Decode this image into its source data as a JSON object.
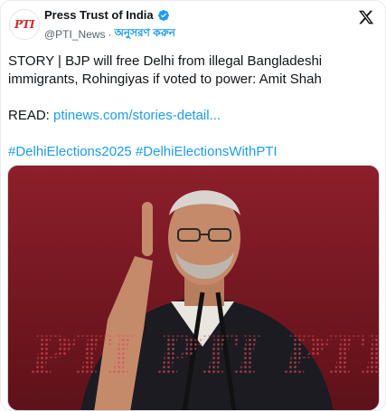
{
  "account": {
    "display_name": "Press Trust of India",
    "handle": "@PTI_News",
    "separator": "·",
    "follow_label": "অনুসরণ করুন",
    "avatar_text": "PTI"
  },
  "tweet": {
    "line1": "STORY | BJP will free Delhi from illegal Bangladeshi immigrants, Rohingiyas if voted to power: Amit Shah",
    "read_prefix": "READ: ",
    "link_text": "ptinews.com/stories-detail...",
    "hashtags": "#DelhiElections2025 #DelhiElectionsWithPTI"
  },
  "media": {
    "watermark": "PTI",
    "colors": {
      "background": "#7a1a24",
      "accent": "#d22a2a"
    }
  },
  "icons": {
    "verified": "verified-badge-icon",
    "x": "x-logo-icon"
  },
  "colors": {
    "link": "#1d9bf0",
    "text": "#0f1419",
    "muted": "#536471"
  }
}
